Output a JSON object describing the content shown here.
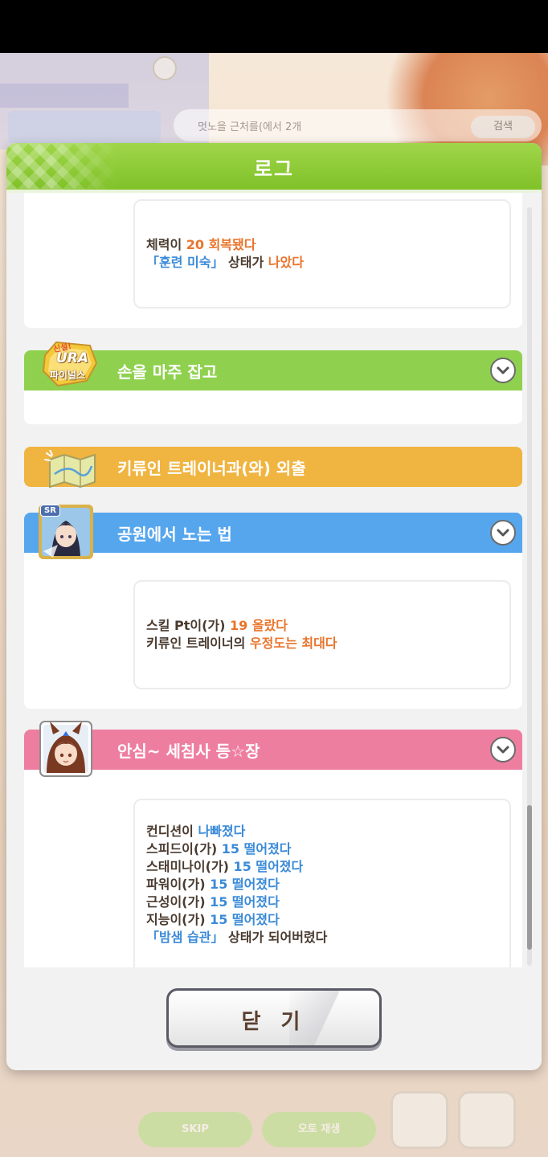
{
  "modal": {
    "title": "로그",
    "close_label": "닫 기"
  },
  "entries": [
    {
      "kind": "result_only",
      "lines": [
        [
          {
            "t": "체력이 ",
            "c": ""
          },
          {
            "t": "20 회복됐다",
            "c": "orange"
          }
        ],
        [
          {
            "t": "「훈련 미숙」",
            "c": "blue"
          },
          {
            "t": " 상태가 ",
            "c": ""
          },
          {
            "t": "나았다",
            "c": "orange"
          }
        ]
      ]
    },
    {
      "kind": "event",
      "title": "손을 마주 잡고",
      "bar_color": "#8fd14f",
      "icon": "ura-finals-logo-icon",
      "icon_text_top": "신설!",
      "icon_text_mid": "URA",
      "icon_text_bottom": "파이널스"
    },
    {
      "kind": "event",
      "title": "키류인 트레이너과(와) 외출",
      "bar_color": "#f0b440",
      "icon": "map-icon"
    },
    {
      "kind": "event",
      "title": "공원에서 노는 법",
      "bar_color": "#56a6ee",
      "icon": "support-card-sr-icon",
      "icon_badge": "SR",
      "lines": [
        [
          {
            "t": "스킬 Pt이(가) ",
            "c": ""
          },
          {
            "t": "19 올랐다",
            "c": "orange"
          }
        ],
        [
          {
            "t": "키류인 트레이너의 ",
            "c": ""
          },
          {
            "t": "우정도는 최대다",
            "c": "orange"
          }
        ]
      ]
    },
    {
      "kind": "event",
      "title": "안심~ 세침사 등☆장",
      "bar_color": "#ee7ea0",
      "icon": "character-portrait-icon",
      "lines": [
        [
          {
            "t": "컨디션이 ",
            "c": ""
          },
          {
            "t": "나빠졌다",
            "c": "blue"
          }
        ],
        [
          {
            "t": "스피드이(가) ",
            "c": ""
          },
          {
            "t": "15 떨어졌다",
            "c": "blue"
          }
        ],
        [
          {
            "t": "스태미나이(가) ",
            "c": ""
          },
          {
            "t": "15 떨어졌다",
            "c": "blue"
          }
        ],
        [
          {
            "t": "파워이(가) ",
            "c": ""
          },
          {
            "t": "15 떨어졌다",
            "c": "blue"
          }
        ],
        [
          {
            "t": "근성이(가) ",
            "c": ""
          },
          {
            "t": "15 떨어졌다",
            "c": "blue"
          }
        ],
        [
          {
            "t": "지능이(가) ",
            "c": ""
          },
          {
            "t": "15 떨어졌다",
            "c": "blue"
          }
        ],
        [
          {
            "t": "「밤샘 습관」",
            "c": "blue"
          },
          {
            "t": " 상태가 되어버렸다",
            "c": ""
          }
        ]
      ]
    }
  ],
  "background": {
    "search_placeholder": "멋노을 근처를(에서 2개",
    "search_button": "검색",
    "skip_label": "SKIP",
    "auto_label": "오토 재생"
  },
  "colors": {
    "header_green": "#8cc93a",
    "text_orange": "#e9742b",
    "text_blue": "#3a8ad8",
    "text_dark": "#4a3b30"
  }
}
